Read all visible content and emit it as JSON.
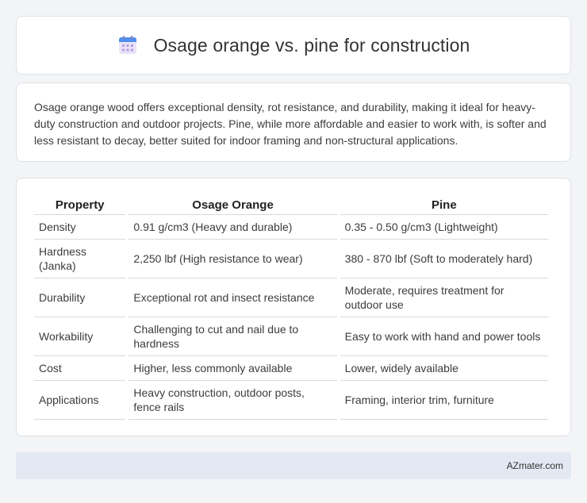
{
  "header": {
    "title": "Osage orange vs. pine for construction",
    "icon": "calendar-icon"
  },
  "summary": {
    "text": "Osage orange wood offers exceptional density, rot resistance, and durability, making it ideal for heavy-duty construction and outdoor projects. Pine, while more affordable and easier to work with, is softer and less resistant to decay, better suited for indoor framing and non-structural applications."
  },
  "table": {
    "headers": [
      "Property",
      "Osage Orange",
      "Pine"
    ],
    "rows": [
      [
        "Density",
        "0.91 g/cm3 (Heavy and durable)",
        "0.35 - 0.50 g/cm3 (Lightweight)"
      ],
      [
        "Hardness (Janka)",
        "2,250 lbf (High resistance to wear)",
        "380 - 870 lbf (Soft to moderately hard)"
      ],
      [
        "Durability",
        "Exceptional rot and insect resistance",
        "Moderate, requires treatment for outdoor use"
      ],
      [
        "Workability",
        "Challenging to cut and nail due to hardness",
        "Easy to work with hand and power tools"
      ],
      [
        "Cost",
        "Higher, less commonly available",
        "Lower, widely available"
      ],
      [
        "Applications",
        "Heavy construction, outdoor posts, fence rails",
        "Framing, interior trim, furniture"
      ]
    ]
  },
  "footer": {
    "text": "AZmater.com"
  }
}
